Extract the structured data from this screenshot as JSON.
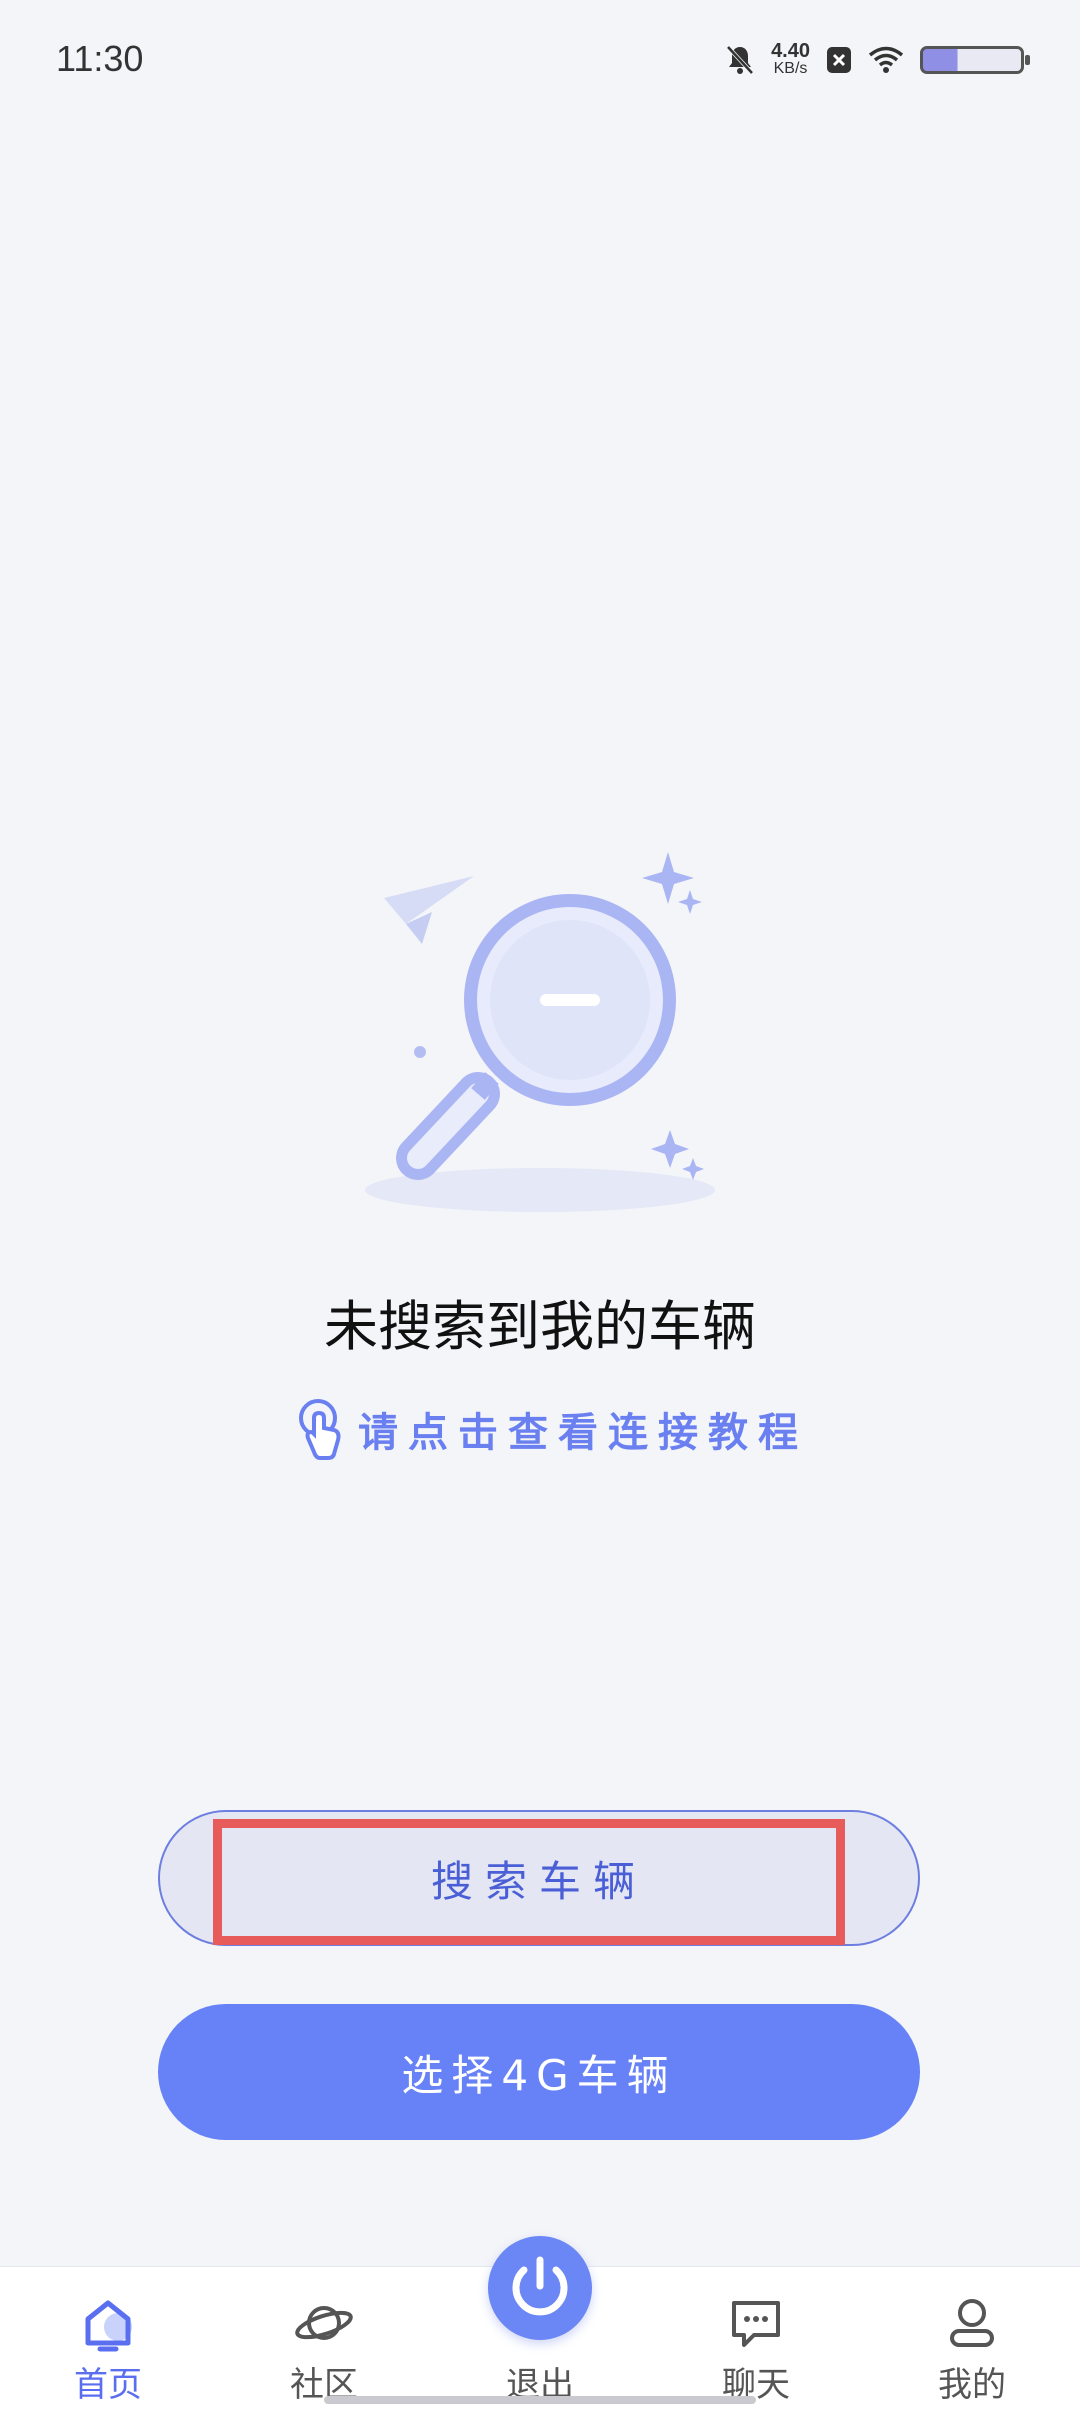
{
  "status": {
    "time": "11:30",
    "net_speed_value": "4.40",
    "net_speed_unit": "KB/s"
  },
  "empty_state": {
    "title": "未搜索到我的车辆",
    "tutorial_link": "请点击查看连接教程"
  },
  "buttons": {
    "search": "搜索车辆",
    "choose_4g": "选择4G车辆"
  },
  "tabs": [
    {
      "label": "首页",
      "icon": "home-icon",
      "active": true
    },
    {
      "label": "社区",
      "icon": "planet-icon"
    },
    {
      "label": "退出",
      "icon": "power-icon"
    },
    {
      "label": "聊天",
      "icon": "chat-icon"
    },
    {
      "label": "我的",
      "icon": "user-icon"
    }
  ],
  "colors": {
    "accent": "#6782f7",
    "link": "#6a80f0",
    "highlight": "#e85b5b"
  }
}
